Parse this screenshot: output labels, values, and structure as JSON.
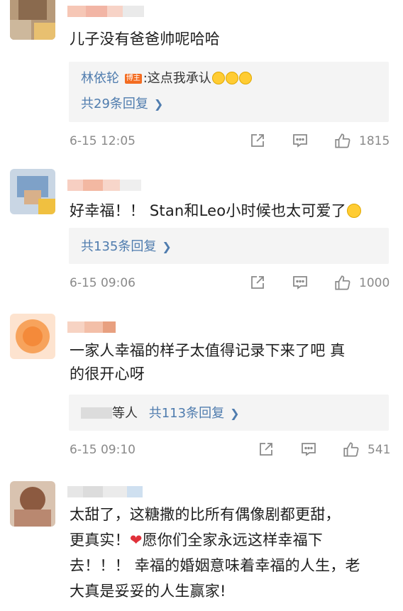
{
  "comments": [
    {
      "text": "儿子没有爸爸帅呢哈哈",
      "reply": {
        "author": "林依轮",
        "badge": "博主",
        "text": ":这点我承认",
        "count_label": "共29条回复"
      },
      "time": "6-15 12:05",
      "likes": "1815"
    },
    {
      "text": "好幸福！！ Stan和Leo小时候也太可爱了",
      "reply": {
        "count_label": "共135条回复"
      },
      "time": "6-15 09:06",
      "likes": "1000"
    },
    {
      "text_line1": "一家人幸福的样子太值得记录下来了吧 真",
      "text_line2": "的很开心呀",
      "reply": {
        "prefix": "等人",
        "count_label": "共113条回复"
      },
      "time": "6-15 09:10",
      "likes": "541"
    },
    {
      "text_line1": "太甜了，这糖撒的比所有偶像剧都更甜，",
      "text_line2a": "更真实！",
      "text_line2b": "愿你们全家永远这样幸福下",
      "text_line3": "去！！！ 幸福的婚姻意味着幸福的人生，老",
      "text_line4": "大真是妥妥的人生赢家!"
    }
  ],
  "icons": {
    "share": "share-icon",
    "comment": "comment-icon",
    "like": "thumbs-up-icon",
    "chevron": "chevron-right-icon"
  }
}
